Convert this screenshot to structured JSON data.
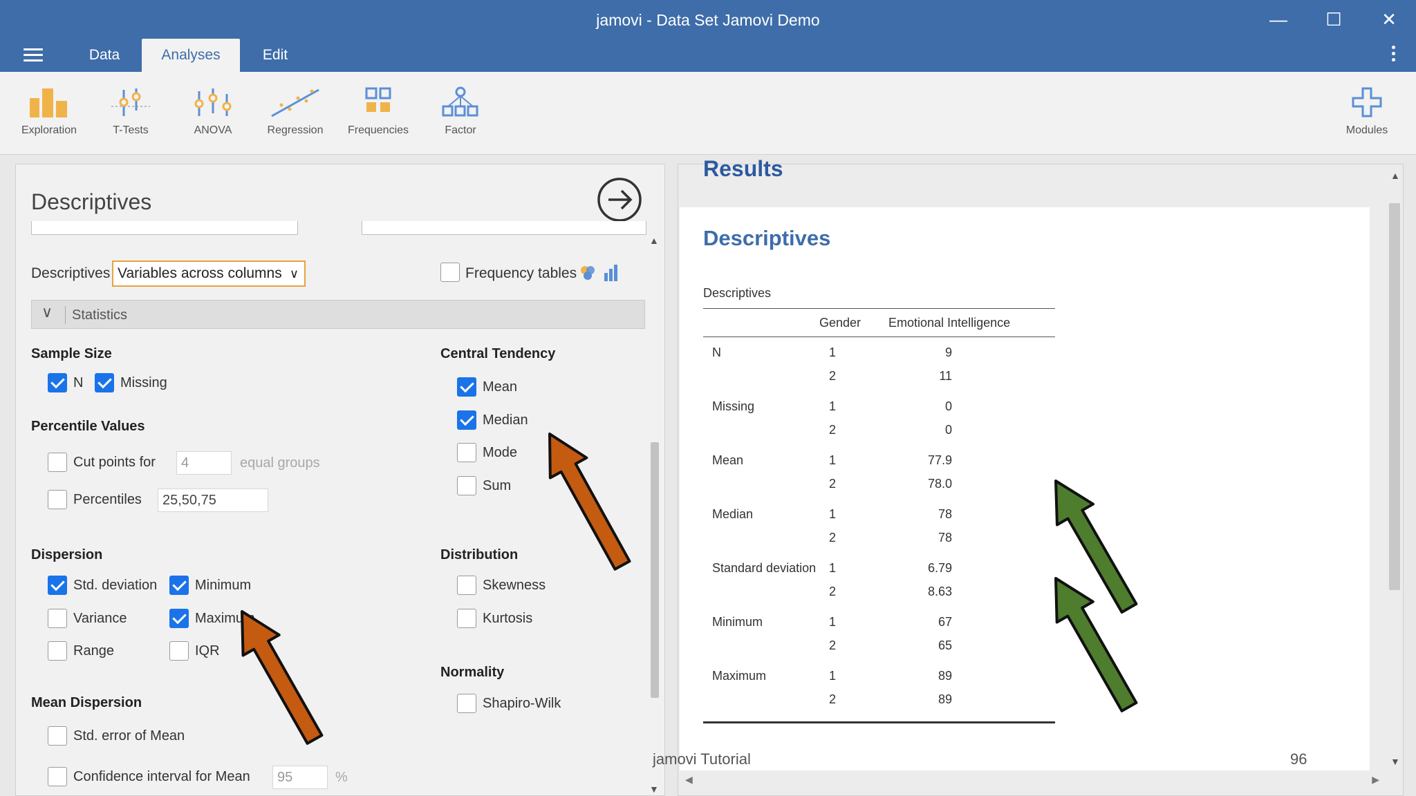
{
  "window": {
    "title": "jamovi - Data Set Jamovi Demo"
  },
  "tabs": [
    {
      "label": "Data"
    },
    {
      "label": "Analyses"
    },
    {
      "label": "Edit"
    }
  ],
  "ribbon": {
    "items": [
      {
        "label": "Exploration",
        "icon": "exploration-icon"
      },
      {
        "label": "T-Tests",
        "icon": "ttests-icon"
      },
      {
        "label": "ANOVA",
        "icon": "anova-icon"
      },
      {
        "label": "Regression",
        "icon": "regression-icon"
      },
      {
        "label": "Frequencies",
        "icon": "frequencies-icon"
      },
      {
        "label": "Factor",
        "icon": "factor-icon"
      }
    ],
    "modules_label": "Modules"
  },
  "options": {
    "title": "Descriptives",
    "descriptives_label": "Descriptives",
    "descriptives_value": "Variables across columns",
    "frequency_tables": {
      "label": "Frequency tables",
      "checked": false
    },
    "statistics_header": "Statistics",
    "sample_size": {
      "title": "Sample Size",
      "n": {
        "label": "N",
        "checked": true
      },
      "missing": {
        "label": "Missing",
        "checked": true
      }
    },
    "percentile": {
      "title": "Percentile Values",
      "cut_points": {
        "label": "Cut points for",
        "checked": false,
        "value": "4",
        "suffix": "equal groups"
      },
      "percentiles": {
        "label": "Percentiles",
        "checked": false,
        "value": "25,50,75"
      }
    },
    "dispersion": {
      "title": "Dispersion",
      "std_dev": {
        "label": "Std. deviation",
        "checked": true
      },
      "minimum": {
        "label": "Minimum",
        "checked": true
      },
      "variance": {
        "label": "Variance",
        "checked": false
      },
      "maximum": {
        "label": "Maximum",
        "checked": true
      },
      "range": {
        "label": "Range",
        "checked": false
      },
      "iqr": {
        "label": "IQR",
        "checked": false
      }
    },
    "mean_dispersion": {
      "title": "Mean Dispersion",
      "se_mean": {
        "label": "Std. error of Mean",
        "checked": false
      },
      "ci_mean": {
        "label": "Confidence interval for Mean",
        "checked": false,
        "value": "95",
        "suffix": "%"
      }
    },
    "central_tendency": {
      "title": "Central Tendency",
      "mean": {
        "label": "Mean",
        "checked": true
      },
      "median": {
        "label": "Median",
        "checked": true
      },
      "mode": {
        "label": "Mode",
        "checked": false
      },
      "sum": {
        "label": "Sum",
        "checked": false
      }
    },
    "distribution": {
      "title": "Distribution",
      "skewness": {
        "label": "Skewness",
        "checked": false
      },
      "kurtosis": {
        "label": "Kurtosis",
        "checked": false
      }
    },
    "normality": {
      "title": "Normality",
      "shapiro": {
        "label": "Shapiro-Wilk",
        "checked": false
      }
    }
  },
  "results": {
    "heading": "Results",
    "title": "Descriptives",
    "table": {
      "caption": "Descriptives",
      "columns": [
        "",
        "Gender",
        "Emotional Intelligence"
      ],
      "rows": [
        {
          "stat": "N",
          "g1": "1",
          "v1": "9",
          "g2": "2",
          "v2": "11"
        },
        {
          "stat": "Missing",
          "g1": "1",
          "v1": "0",
          "g2": "2",
          "v2": "0"
        },
        {
          "stat": "Mean",
          "g1": "1",
          "v1": "77.9",
          "g2": "2",
          "v2": "78.0"
        },
        {
          "stat": "Median",
          "g1": "1",
          "v1": "78",
          "g2": "2",
          "v2": "78"
        },
        {
          "stat": "Standard deviation",
          "g1": "1",
          "v1": "6.79",
          "g2": "2",
          "v2": "8.63"
        },
        {
          "stat": "Minimum",
          "g1": "1",
          "v1": "67",
          "g2": "2",
          "v2": "65"
        },
        {
          "stat": "Maximum",
          "g1": "1",
          "v1": "89",
          "g2": "2",
          "v2": "89"
        }
      ]
    }
  },
  "overlay": {
    "footer": "jamovi Tutorial",
    "page_number": "96",
    "arrow_colors": {
      "orange": "#c55a11",
      "green": "#4e7d2e"
    }
  },
  "colors": {
    "header": "#3e6da9",
    "accent": "#1a73e8",
    "select_border": "#e8a33a",
    "icon_orange": "#f0b34a",
    "icon_blue": "#5b8fd6"
  }
}
